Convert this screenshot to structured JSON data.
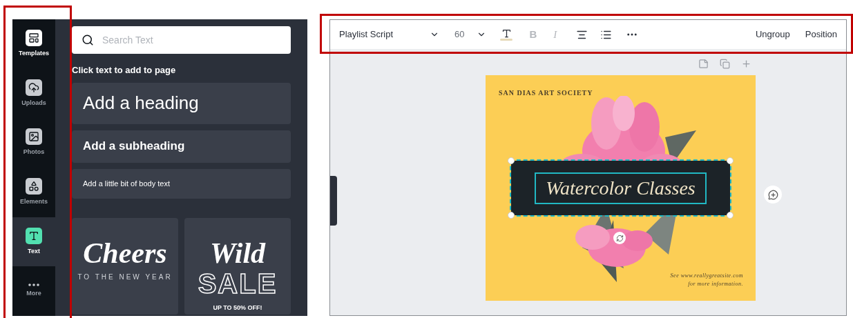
{
  "sidebar": {
    "items": [
      {
        "kind": "templates",
        "label": "Templates",
        "selected": false
      },
      {
        "kind": "uploads",
        "label": "Uploads",
        "selected": false
      },
      {
        "kind": "photos",
        "label": "Photos",
        "selected": false
      },
      {
        "kind": "elements",
        "label": "Elements",
        "selected": false
      },
      {
        "kind": "text",
        "label": "Text",
        "selected": true
      },
      {
        "kind": "more",
        "label": "More",
        "selected": false
      }
    ]
  },
  "text_panel": {
    "search": {
      "placeholder": "Search Text"
    },
    "hint": "Click text to add to page",
    "presets": [
      {
        "kind": "heading",
        "label": "Add a heading"
      },
      {
        "kind": "subheading",
        "label": "Add a subheading"
      },
      {
        "kind": "body",
        "label": "Add a little bit of body text"
      }
    ],
    "templates": [
      {
        "lines": [
          {
            "kind": "script",
            "text": "Cheers"
          },
          {
            "kind": "caps",
            "text": "TO THE NEW YEAR"
          }
        ]
      },
      {
        "lines": [
          {
            "kind": "script",
            "text": "Wild"
          },
          {
            "kind": "outline",
            "text": "SALE"
          },
          {
            "kind": "bold",
            "text": "UP TO 50% OFF!"
          }
        ]
      }
    ]
  },
  "toolbar": {
    "font": "Playlist Script",
    "size": "60",
    "bold": {
      "label": "B",
      "disabled": true
    },
    "italic": {
      "label": "I",
      "disabled": true
    },
    "actions": [
      "Ungroup",
      "Position"
    ]
  },
  "poster": {
    "org": "SAN DIAS ART SOCIETY",
    "title": "Watercolor Classes",
    "title_selected": true,
    "footer": [
      "See www.reallygreatsite.com",
      "for more information."
    ]
  }
}
